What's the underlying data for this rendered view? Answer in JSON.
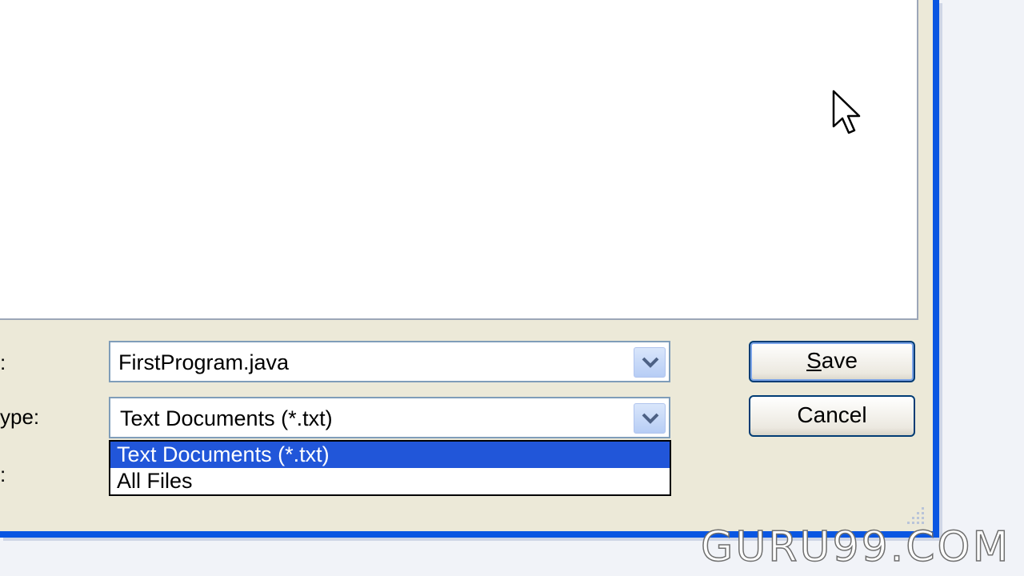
{
  "form": {
    "filename_label": ":",
    "filename_value": "FirstProgram.java",
    "filetype_label": "ype:",
    "filetype_value": "Text Documents (*.txt)",
    "encoding_label": ":"
  },
  "dropdown": {
    "options": [
      "Text Documents (*.txt)",
      "All Files"
    ],
    "selected_index": 0
  },
  "buttons": {
    "save_prefix": "S",
    "save_rest": "ave",
    "cancel_label": "Cancel"
  },
  "watermark": "GURU99.COM",
  "colors": {
    "dialog_bg": "#ece9d8",
    "window_border": "#0a56e2",
    "selection": "#2156d9"
  },
  "icons": [
    "chevron-down-icon",
    "mouse-cursor-icon",
    "resize-grip-icon"
  ]
}
